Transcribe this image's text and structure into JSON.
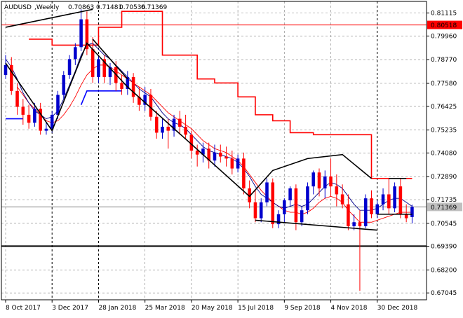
{
  "chart_data": {
    "type": "candlestick",
    "symbol": "AUDUSD",
    "timeframe": "Weekly",
    "ohlc_header": [
      "0.70863",
      "0.71481",
      "0.70536",
      "0.71369"
    ],
    "price_axis": {
      "min": 0.667,
      "max": 0.817,
      "ticks": [
        "0.81115",
        "0.79960",
        "0.78770",
        "0.77580",
        "0.76425",
        "0.75235",
        "0.74080",
        "0.72890",
        "0.71735",
        "0.70545",
        "0.69390",
        "0.68200",
        "0.67045"
      ]
    },
    "time_axis": {
      "labels": [
        "8 Oct 2017",
        "3 Dec 2017",
        "28 Jan 2018",
        "25 Mar 2018",
        "20 May 2018",
        "15 Jul 2018",
        "9 Sep 2018",
        "4 Nov 2018",
        "30 Dec 2018"
      ],
      "label_bar_index": [
        0,
        8,
        16,
        24,
        32,
        40,
        48,
        56,
        64
      ]
    },
    "bar_count": 72,
    "horizontal_levels": [
      {
        "value": 0.80518,
        "label": "0.80518",
        "color": "#ff0000"
      },
      {
        "value": 0.71369,
        "label": "0.71369",
        "color": "#808080"
      },
      {
        "value": 0.694,
        "label": "",
        "color": "#000000"
      }
    ],
    "colors": {
      "bull": "#0000cd",
      "bear": "#ff0000",
      "ma_fast": "#00008b",
      "ma_slow": "#ff0000",
      "trendline": "#000000",
      "stop_resist": "#ff0000",
      "stop_support": "#0000ff",
      "grid": "#808080",
      "current_price_bg": "#c0c0c0",
      "level_price_bg": "#ff0000"
    },
    "candles": [
      [
        0.78,
        0.79,
        0.778,
        0.785
      ],
      [
        0.785,
        0.789,
        0.77,
        0.772
      ],
      [
        0.772,
        0.776,
        0.76,
        0.764
      ],
      [
        0.764,
        0.768,
        0.755,
        0.76
      ],
      [
        0.76,
        0.765,
        0.753,
        0.756
      ],
      [
        0.756,
        0.766,
        0.754,
        0.763
      ],
      [
        0.763,
        0.766,
        0.75,
        0.752
      ],
      [
        0.752,
        0.756,
        0.75,
        0.753
      ],
      [
        0.753,
        0.762,
        0.751,
        0.76
      ],
      [
        0.76,
        0.772,
        0.758,
        0.77
      ],
      [
        0.77,
        0.782,
        0.768,
        0.78
      ],
      [
        0.78,
        0.79,
        0.778,
        0.788
      ],
      [
        0.788,
        0.796,
        0.785,
        0.794
      ],
      [
        0.794,
        0.813,
        0.792,
        0.808
      ],
      [
        0.808,
        0.812,
        0.79,
        0.793
      ],
      [
        0.793,
        0.799,
        0.776,
        0.779
      ],
      [
        0.779,
        0.79,
        0.776,
        0.788
      ],
      [
        0.788,
        0.79,
        0.776,
        0.779
      ],
      [
        0.779,
        0.786,
        0.775,
        0.784
      ],
      [
        0.784,
        0.787,
        0.772,
        0.776
      ],
      [
        0.776,
        0.78,
        0.77,
        0.773
      ],
      [
        0.773,
        0.782,
        0.77,
        0.779
      ],
      [
        0.779,
        0.781,
        0.766,
        0.769
      ],
      [
        0.769,
        0.774,
        0.762,
        0.765
      ],
      [
        0.765,
        0.774,
        0.762,
        0.77
      ],
      [
        0.77,
        0.773,
        0.757,
        0.759
      ],
      [
        0.759,
        0.762,
        0.748,
        0.751
      ],
      [
        0.751,
        0.758,
        0.748,
        0.754
      ],
      [
        0.754,
        0.758,
        0.743,
        0.752
      ],
      [
        0.752,
        0.76,
        0.749,
        0.758
      ],
      [
        0.758,
        0.762,
        0.75,
        0.754
      ],
      [
        0.754,
        0.76,
        0.748,
        0.75
      ],
      [
        0.75,
        0.752,
        0.738,
        0.742
      ],
      [
        0.742,
        0.745,
        0.734,
        0.74
      ],
      [
        0.74,
        0.746,
        0.736,
        0.743
      ],
      [
        0.743,
        0.746,
        0.733,
        0.737
      ],
      [
        0.737,
        0.745,
        0.734,
        0.741
      ],
      [
        0.741,
        0.745,
        0.736,
        0.739
      ],
      [
        0.739,
        0.744,
        0.734,
        0.738
      ],
      [
        0.738,
        0.742,
        0.73,
        0.733
      ],
      [
        0.733,
        0.74,
        0.731,
        0.738
      ],
      [
        0.738,
        0.741,
        0.72,
        0.723
      ],
      [
        0.723,
        0.727,
        0.713,
        0.716
      ],
      [
        0.716,
        0.722,
        0.706,
        0.708
      ],
      [
        0.708,
        0.718,
        0.706,
        0.716
      ],
      [
        0.716,
        0.728,
        0.714,
        0.726
      ],
      [
        0.726,
        0.728,
        0.703,
        0.705
      ],
      [
        0.705,
        0.712,
        0.703,
        0.71
      ],
      [
        0.71,
        0.718,
        0.706,
        0.717
      ],
      [
        0.717,
        0.724,
        0.714,
        0.723
      ],
      [
        0.723,
        0.725,
        0.702,
        0.706
      ],
      [
        0.706,
        0.714,
        0.704,
        0.712
      ],
      [
        0.712,
        0.726,
        0.71,
        0.724
      ],
      [
        0.724,
        0.732,
        0.72,
        0.731
      ],
      [
        0.731,
        0.733,
        0.719,
        0.723
      ],
      [
        0.723,
        0.732,
        0.718,
        0.729
      ],
      [
        0.729,
        0.738,
        0.719,
        0.724
      ],
      [
        0.724,
        0.73,
        0.714,
        0.72
      ],
      [
        0.72,
        0.725,
        0.713,
        0.715
      ],
      [
        0.715,
        0.72,
        0.702,
        0.704
      ],
      [
        0.704,
        0.71,
        0.702,
        0.706
      ],
      [
        0.706,
        0.712,
        0.6715,
        0.704
      ],
      [
        0.704,
        0.72,
        0.703,
        0.718
      ],
      [
        0.718,
        0.722,
        0.708,
        0.71
      ],
      [
        0.71,
        0.717,
        0.708,
        0.715
      ],
      [
        0.715,
        0.723,
        0.712,
        0.72
      ],
      [
        0.72,
        0.728,
        0.71,
        0.713
      ],
      [
        0.713,
        0.726,
        0.711,
        0.724
      ],
      [
        0.724,
        0.728,
        0.708,
        0.71
      ],
      [
        0.71,
        0.715,
        0.706,
        0.708
      ],
      [
        0.7086,
        0.7148,
        0.7054,
        0.7137
      ]
    ],
    "ma_fast_values": [
      0.788,
      0.784,
      0.778,
      0.771,
      0.766,
      0.762,
      0.76,
      0.758,
      0.759,
      0.762,
      0.768,
      0.775,
      0.782,
      0.79,
      0.795,
      0.796,
      0.793,
      0.79,
      0.788,
      0.785,
      0.782,
      0.779,
      0.776,
      0.773,
      0.771,
      0.769,
      0.765,
      0.761,
      0.758,
      0.756,
      0.755,
      0.753,
      0.75,
      0.747,
      0.744,
      0.742,
      0.741,
      0.74,
      0.739,
      0.738,
      0.736,
      0.733,
      0.729,
      0.724,
      0.72,
      0.718,
      0.716,
      0.714,
      0.713,
      0.714,
      0.715,
      0.714,
      0.715,
      0.718,
      0.721,
      0.724,
      0.726,
      0.725,
      0.723,
      0.719,
      0.715,
      0.712,
      0.712,
      0.712,
      0.713,
      0.715,
      0.717,
      0.718,
      0.718,
      0.716,
      0.714
    ],
    "ma_slow_values": [
      null,
      null,
      0.774,
      0.77,
      0.766,
      0.763,
      0.76,
      0.757,
      0.756,
      0.757,
      0.76,
      0.764,
      0.769,
      0.775,
      0.78,
      0.783,
      0.785,
      0.785,
      0.784,
      0.782,
      0.78,
      0.778,
      0.776,
      0.774,
      0.772,
      0.77,
      0.767,
      0.764,
      0.761,
      0.759,
      0.757,
      0.755,
      0.753,
      0.75,
      0.747,
      0.745,
      0.743,
      0.742,
      0.741,
      0.739,
      0.737,
      0.734,
      0.73,
      0.726,
      0.722,
      0.719,
      0.716,
      0.714,
      0.712,
      0.711,
      0.711,
      0.71,
      0.711,
      0.713,
      0.716,
      0.718,
      0.719,
      0.718,
      0.716,
      0.712,
      0.709,
      0.706,
      0.706,
      0.706,
      0.707,
      0.708,
      0.709,
      0.71,
      0.711,
      0.711,
      0.711
    ],
    "stop_resist_steps": [
      [
        4,
        0.798
      ],
      [
        8,
        0.795
      ],
      [
        12,
        0.795
      ],
      [
        16,
        0.804
      ],
      [
        20,
        0.812
      ],
      [
        23,
        0.812
      ],
      [
        27,
        0.79
      ],
      [
        30,
        0.79
      ],
      [
        33,
        0.778
      ],
      [
        36,
        0.776
      ],
      [
        40,
        0.769
      ],
      [
        43,
        0.76
      ],
      [
        46,
        0.757
      ],
      [
        49,
        0.751
      ],
      [
        53,
        0.75
      ],
      [
        58,
        0.75
      ],
      [
        63,
        0.728
      ],
      [
        70,
        0.728
      ]
    ],
    "stop_support_segments": [
      [
        [
          0,
          0.758
        ],
        [
          3,
          0.758
        ]
      ],
      [
        [
          13,
          0.765
        ],
        [
          14,
          0.772
        ],
        [
          20,
          0.772
        ]
      ]
    ],
    "trendlines": [
      [
        [
          0,
          0.804
        ],
        [
          15,
          0.813
        ]
      ],
      [
        [
          0,
          0.786
        ],
        [
          8,
          0.752
        ],
        [
          14,
          0.796
        ],
        [
          21,
          0.774
        ],
        [
          42,
          0.719
        ],
        [
          46,
          0.732
        ],
        [
          52,
          0.738
        ],
        [
          58,
          0.74
        ],
        [
          63,
          0.728
        ]
      ],
      [
        [
          15,
          0.798
        ],
        [
          21,
          0.778
        ]
      ],
      [
        [
          43,
          0.707
        ],
        [
          64,
          0.702
        ]
      ],
      [
        [
          64,
          0.71
        ],
        [
          70,
          0.71
        ]
      ],
      [
        [
          66,
          0.728
        ],
        [
          69,
          0.728
        ]
      ]
    ],
    "vertical_dashed_at_bar": [
      8,
      16,
      64
    ]
  }
}
